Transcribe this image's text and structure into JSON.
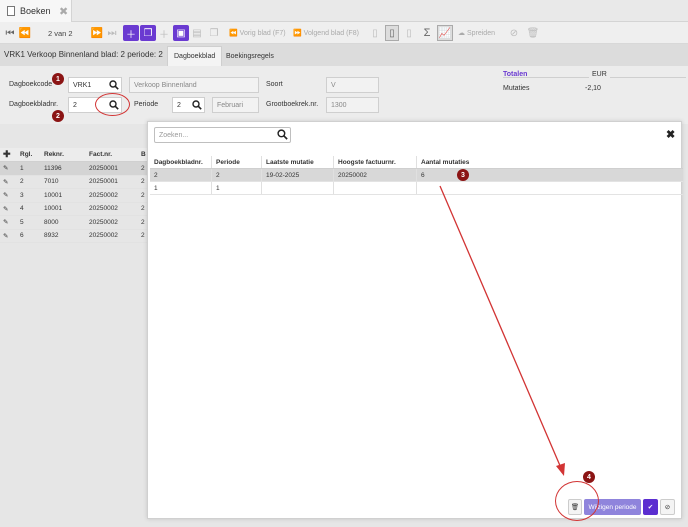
{
  "tab": {
    "label": "Boeken",
    "icon": "document-icon",
    "close_icon": "close-icon"
  },
  "toolbar": {
    "record_counter": "2 van 2",
    "prev_sheet_label": "Vorig blad (F7)",
    "next_sheet_label": "Volgend blad (F8)",
    "spread_label": "Spreiden"
  },
  "header": {
    "title": "VRK1 Verkoop Binnenland blad: 2 periode: 2",
    "tabs": [
      {
        "label": "Dagboekblad",
        "active": true
      },
      {
        "label": "Boekingsregels",
        "active": false
      }
    ]
  },
  "form": {
    "dagboekcode_label": "Dagboekcode",
    "dagboekcode_value": "VRK1",
    "dagboek_name": "Verkoop Binnenland",
    "soort_label": "Soort",
    "soort_value": "V",
    "dagboekbladnr_label": "Dagboekbladnr.",
    "dagboekbladnr_value": "2",
    "periode_label": "Periode",
    "periode_value": "2",
    "periode_name": "Februari",
    "grootboek_label": "Grootboekrek.nr.",
    "grootboek_value": "1300"
  },
  "totals": {
    "heading": "Totalen",
    "currency": "EUR",
    "mutaties_label": "Mutaties",
    "mutaties_value": "-2,10"
  },
  "background_grid": {
    "add_icon": "plus-icon",
    "columns": [
      "Rgl.",
      "Reknr.",
      "Fact.nr.",
      "B"
    ],
    "rows": [
      {
        "rgl": "1",
        "reknr": "11396",
        "factnr": "20250001",
        "b": "2"
      },
      {
        "rgl": "2",
        "reknr": "7010",
        "factnr": "20250001",
        "b": "2"
      },
      {
        "rgl": "3",
        "reknr": "10001",
        "factnr": "20250002",
        "b": "2"
      },
      {
        "rgl": "4",
        "reknr": "10001",
        "factnr": "20250002",
        "b": "2"
      },
      {
        "rgl": "5",
        "reknr": "8000",
        "factnr": "20250002",
        "b": "2"
      },
      {
        "rgl": "6",
        "reknr": "8932",
        "factnr": "20250002",
        "b": "2"
      }
    ]
  },
  "modal": {
    "search_placeholder": "Zoeken...",
    "columns": [
      "Dagboekbladnr.",
      "Periode",
      "Laatste mutatie",
      "Hoogste factuurnr.",
      "Aantal mutaties"
    ],
    "rows": [
      {
        "bladnr": "2",
        "periode": "2",
        "laatste": "19-02-2025",
        "hoogste": "20250002",
        "aantal": "6"
      },
      {
        "bladnr": "1",
        "periode": "1",
        "laatste": "",
        "hoogste": "",
        "aantal": ""
      }
    ],
    "wijzigen_label": "Wijzigen periode"
  },
  "callouts": [
    "1",
    "2",
    "3",
    "4"
  ],
  "colors": {
    "accent": "#6a3ad1",
    "callout": "#8b1414",
    "annotation": "#d23434"
  }
}
